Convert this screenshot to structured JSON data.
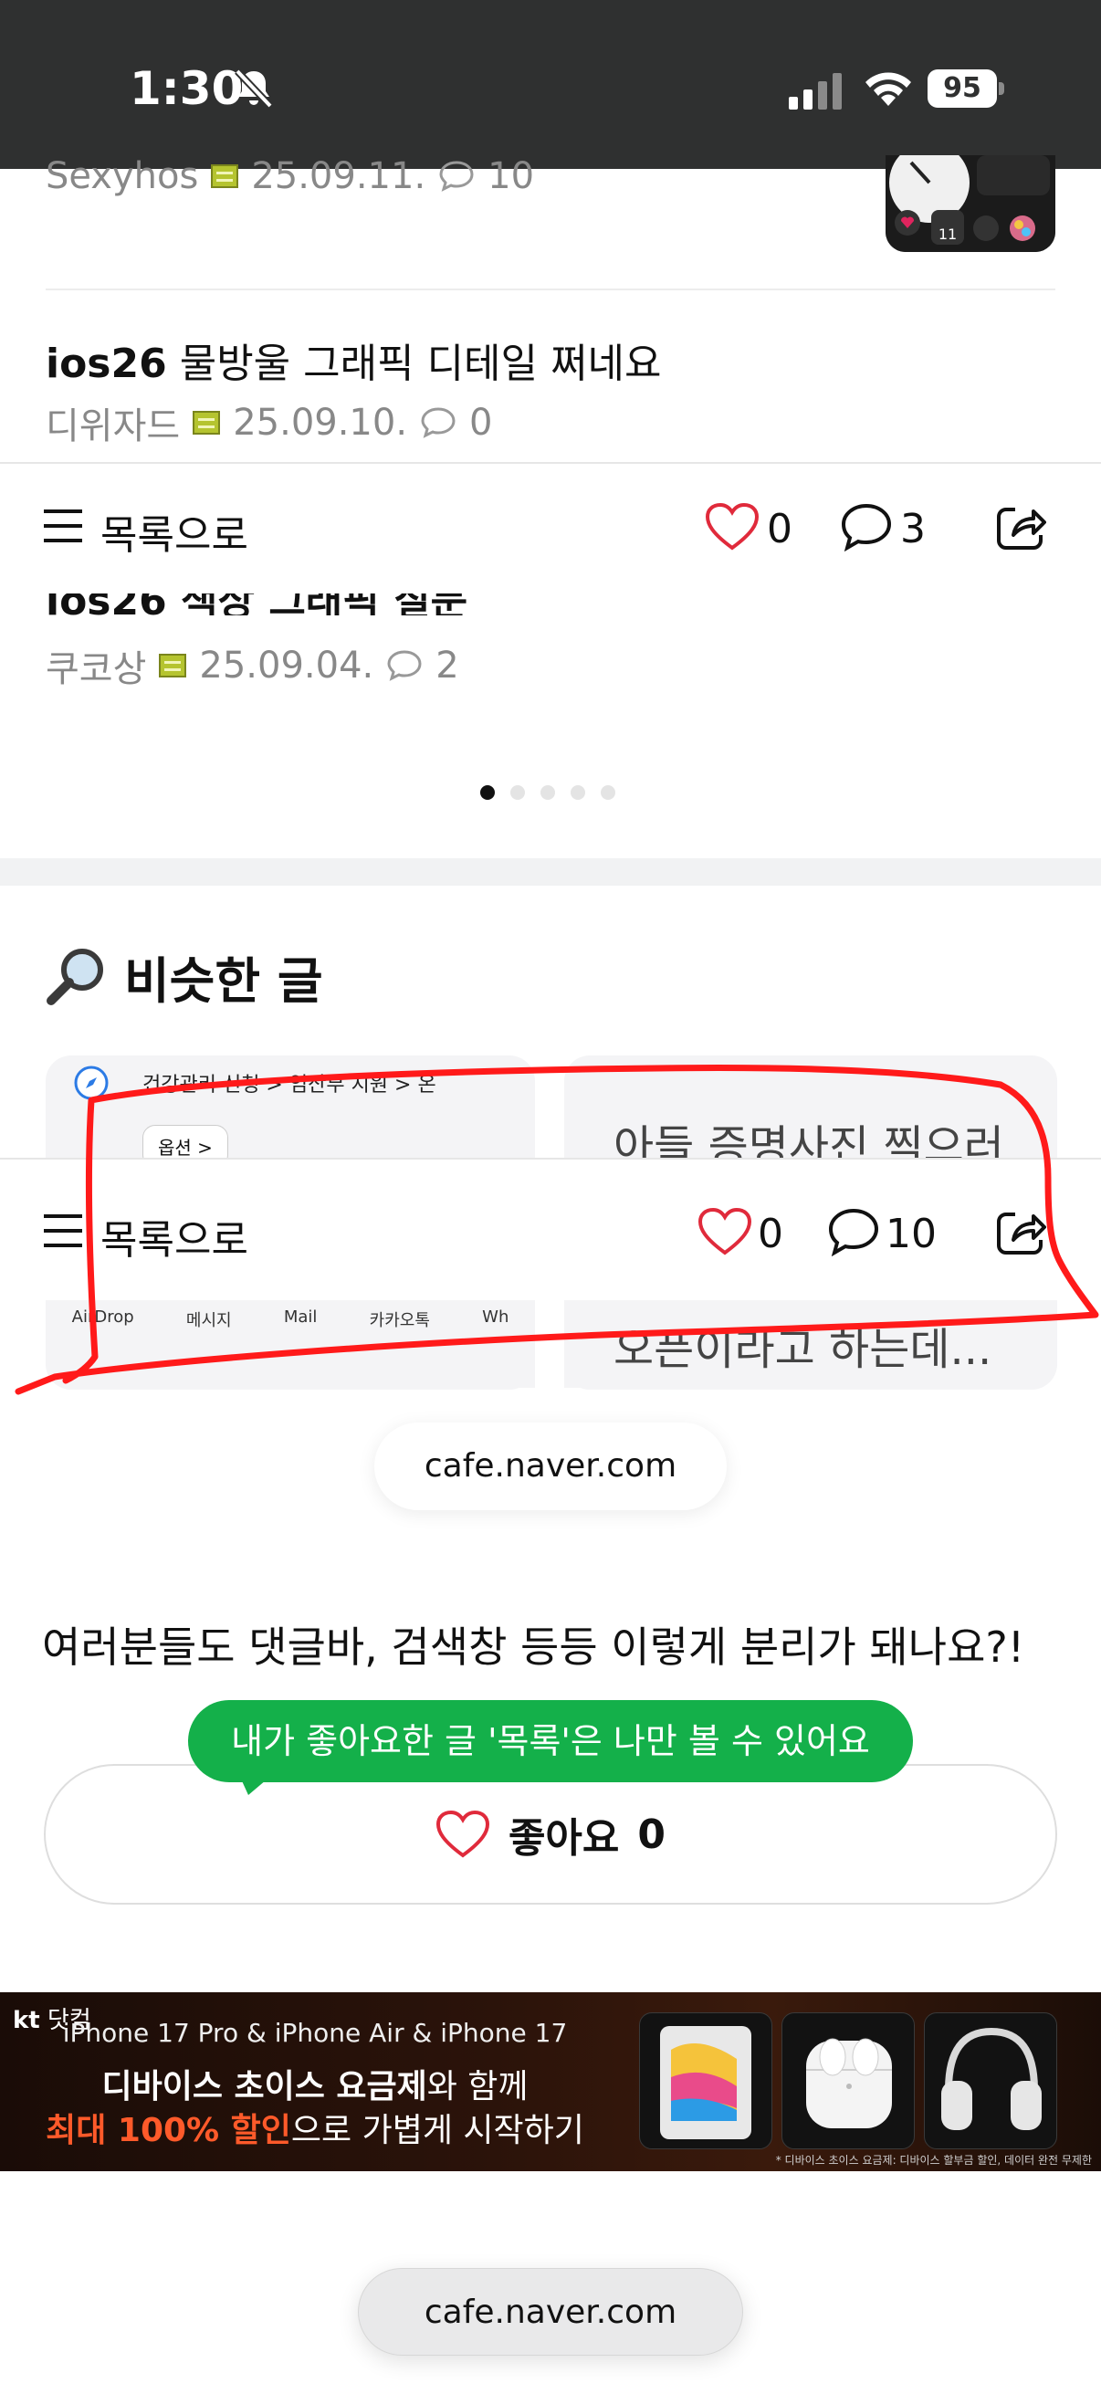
{
  "status_bar": {
    "time": "1:30",
    "battery": "95"
  },
  "posts": [
    {
      "author": "Sexyhos",
      "date": "25.09.11.",
      "comments": "10"
    },
    {
      "title_bold": "ios26",
      "title_rest": " 물방울 그래픽 디테일 쩌네요",
      "author": "디위자드",
      "date": "25.09.10.",
      "comments": "0"
    },
    {
      "author": "쿠코상",
      "date": "25.09.04.",
      "comments": "2"
    }
  ],
  "bottom_bar_1": {
    "label": "목록으로",
    "likes": "0",
    "comments": "3"
  },
  "similar": {
    "title": "비슷한 글"
  },
  "cards": {
    "left_top_text": "건강관리 신청 > 임산부 지원 > 온",
    "left_button": "옵션 >",
    "left_share_items": [
      "AirDrop",
      "메시지",
      "Mail",
      "카카오톡",
      "Wh"
    ],
    "right_line1": "아들 증명사진 찍으러",
    "right_line2": "오픈이라고 하는데..."
  },
  "bottom_bar_2": {
    "label": "목록으로",
    "likes": "0",
    "comments": "10"
  },
  "url_pill_top": "cafe.naver.com",
  "question": "여러분들도 댓글바, 검색창 등등 이렇게 분리가 돼나요?!",
  "tooltip": "내가 좋아요한 글 '목록'은 나만 볼 수 있어요",
  "like_button": {
    "label": "좋아요",
    "count": "0"
  },
  "ad": {
    "brand_kt": "kt",
    "brand_rest": "닷컴",
    "line1": "iPhone 17 Pro & iPhone Air & iPhone 17",
    "line2_bold": "디바이스 초이스 요금제",
    "line2_rest": "와 함께",
    "line3_hl": "최대 100% 할인",
    "line3_rest": "으로 가볍게 시작하기",
    "fine_print": "* 디바이스 초이스 요금제: 디바이스 할부금 할인, 데이터 완전 무제한"
  },
  "url_pill_bottom": "cafe.naver.com",
  "colors": {
    "status_bg": "#2f3030",
    "heart": "#e02a3b",
    "tooltip": "#14b04a",
    "annotation": "#ff1a1a"
  }
}
